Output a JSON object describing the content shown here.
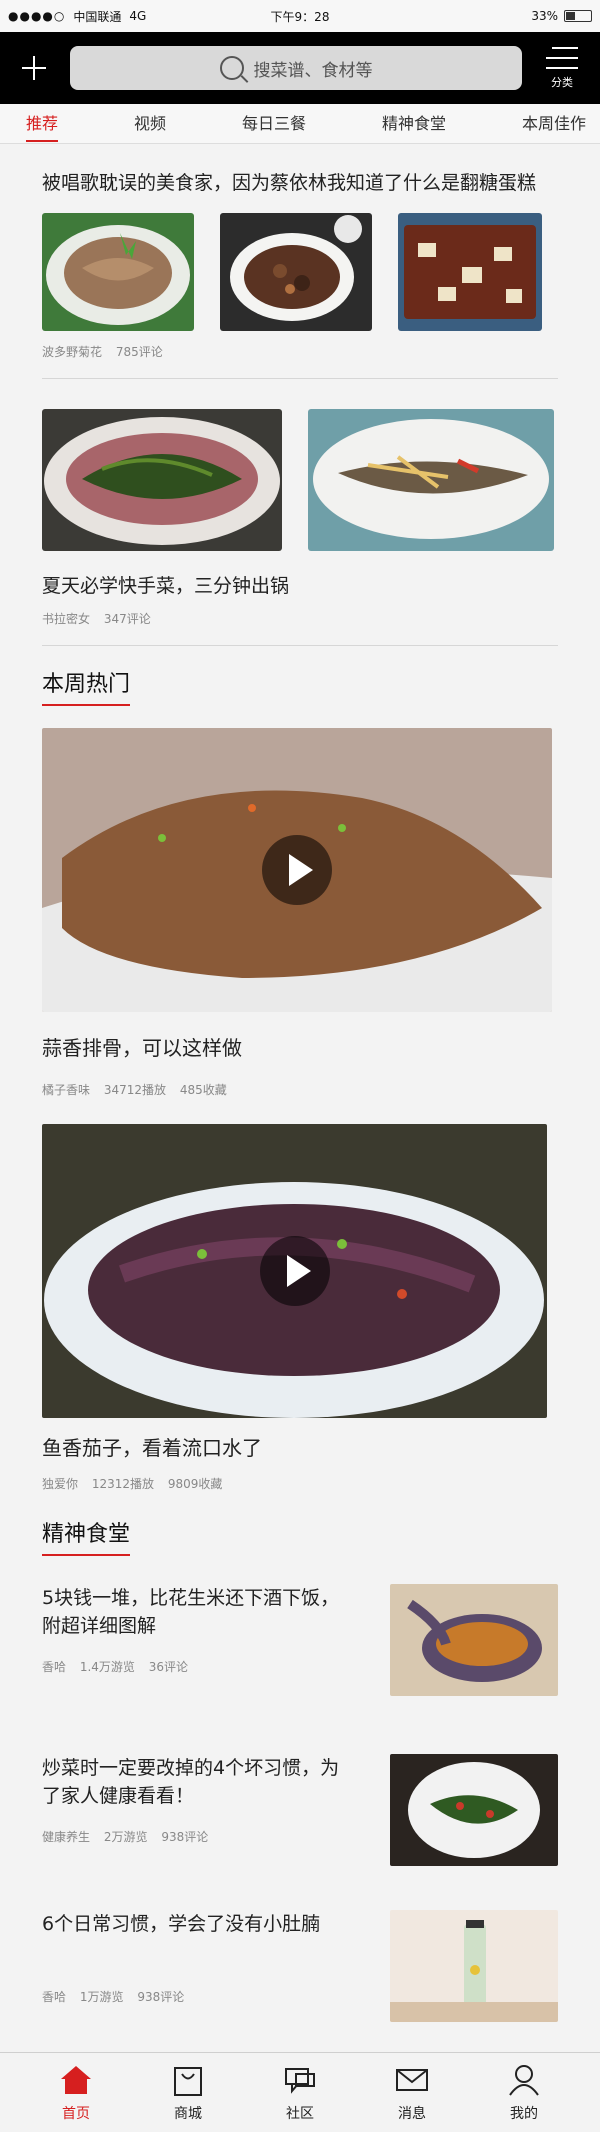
{
  "status": {
    "carrier": "中国联通",
    "network": "4G",
    "time": "下午9：28",
    "battery": "33%"
  },
  "header": {
    "search_placeholder": "搜菜谱、食材等",
    "category_label": "分类"
  },
  "tabs": [
    "推荐",
    "视频",
    "每日三餐",
    "精神食堂",
    "本周佳作"
  ],
  "feed": [
    {
      "title": "被唱歌耽误的美食家，因为蔡依林我知道了什么是翻糖蛋糕",
      "author": "波多野菊花",
      "comments": "785评论"
    },
    {
      "title": "夏天必学快手菜，三分钟出锅",
      "author": "书拉密女",
      "comments": "347评论"
    }
  ],
  "hot": {
    "heading": "本周热门",
    "items": [
      {
        "title": "蒜香排骨，可以这样做",
        "author": "橘子香味",
        "plays": "34712播放",
        "favs": "485收藏"
      },
      {
        "title": "鱼香茄子，看着流口水了",
        "author": "独爱你",
        "plays": "12312播放",
        "favs": "9809收藏"
      }
    ]
  },
  "canteen": {
    "heading": "精神食堂",
    "items": [
      {
        "title": "5块钱一堆，比花生米还下酒下饭，附超详细图解",
        "author": "香哈",
        "views": "1.4万游览",
        "comments": "36评论"
      },
      {
        "title": "炒菜时一定要改掉的4个坏习惯，为了家人健康看看！",
        "author": "健康养生",
        "views": "2万游览",
        "comments": "938评论"
      },
      {
        "title": "6个日常习惯，学会了没有小肚腩",
        "author": "香哈",
        "views": "1万游览",
        "comments": "938评论"
      }
    ]
  },
  "bottom_nav": [
    "首页",
    "商城",
    "社区",
    "消息",
    "我的"
  ],
  "colors": {
    "accent": "#d61f1f",
    "header_bg": "#000000"
  }
}
